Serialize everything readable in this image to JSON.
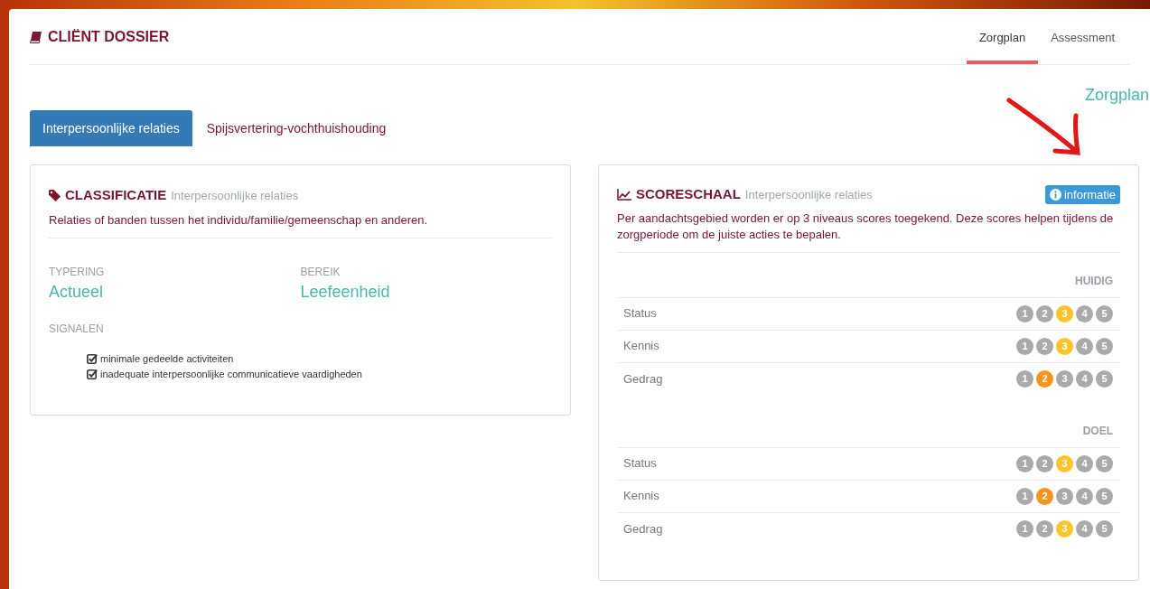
{
  "header": {
    "title": "CLIËNT DOSSIER",
    "tabs": [
      {
        "label": "Zorgplan",
        "selected": true
      },
      {
        "label": "Assessment",
        "selected": false
      }
    ]
  },
  "section_title": "Zorgplan",
  "pills": [
    {
      "label": "Interpersoonlijke relaties",
      "selected": true
    },
    {
      "label": "Spijsvertering-vochthuishouding",
      "selected": false
    }
  ],
  "classificatie": {
    "title": "CLASSIFICATIE",
    "subtitle": "Interpersoonlijke relaties",
    "description": "Relaties of banden tussen het individu/familie/gemeenschap en anderen.",
    "fields": [
      {
        "label": "TYPERING",
        "value": "Actueel"
      },
      {
        "label": "BEREIK",
        "value": "Leefeenheid"
      }
    ],
    "signals_label": "SIGNALEN",
    "signals": [
      {
        "text": "minimale gedeelde activiteiten",
        "checked": true
      },
      {
        "text": "inadequate interpersoonlijke communicatieve vaardigheden",
        "checked": true
      }
    ]
  },
  "scoreschaal": {
    "title": "SCORESCHAAL",
    "subtitle": "Interpersoonlijke relaties",
    "info_button": "informatie",
    "description": "Per aandachtsgebied worden er op 3 niveaus scores toegekend. Deze scores helpen tijdens de zorgperiode om de juiste acties te bepalen.",
    "groups": [
      {
        "heading": "HUIDIG",
        "rows": [
          {
            "label": "Status",
            "scores": [
              {
                "label": "1",
                "color": "#aaaaaa"
              },
              {
                "label": "2",
                "color": "#aaaaaa"
              },
              {
                "label": "3",
                "color": "#fdc52a"
              },
              {
                "label": "4",
                "color": "#aaaaaa"
              },
              {
                "label": "5",
                "color": "#aaaaaa"
              }
            ]
          },
          {
            "label": "Kennis",
            "scores": [
              {
                "label": "1",
                "color": "#aaaaaa"
              },
              {
                "label": "2",
                "color": "#aaaaaa"
              },
              {
                "label": "3",
                "color": "#fdc52a"
              },
              {
                "label": "4",
                "color": "#aaaaaa"
              },
              {
                "label": "5",
                "color": "#aaaaaa"
              }
            ]
          },
          {
            "label": "Gedrag",
            "scores": [
              {
                "label": "1",
                "color": "#aaaaaa"
              },
              {
                "label": "2",
                "color": "#f7941d"
              },
              {
                "label": "3",
                "color": "#aaaaaa"
              },
              {
                "label": "4",
                "color": "#aaaaaa"
              },
              {
                "label": "5",
                "color": "#aaaaaa"
              }
            ]
          }
        ]
      },
      {
        "heading": "DOEL",
        "rows": [
          {
            "label": "Status",
            "scores": [
              {
                "label": "1",
                "color": "#aaaaaa"
              },
              {
                "label": "2",
                "color": "#aaaaaa"
              },
              {
                "label": "3",
                "color": "#fdc52a"
              },
              {
                "label": "4",
                "color": "#aaaaaa"
              },
              {
                "label": "5",
                "color": "#aaaaaa"
              }
            ]
          },
          {
            "label": "Kennis",
            "scores": [
              {
                "label": "1",
                "color": "#aaaaaa"
              },
              {
                "label": "2",
                "color": "#f7941d"
              },
              {
                "label": "3",
                "color": "#aaaaaa"
              },
              {
                "label": "4",
                "color": "#aaaaaa"
              },
              {
                "label": "5",
                "color": "#aaaaaa"
              }
            ]
          },
          {
            "label": "Gedrag",
            "scores": [
              {
                "label": "1",
                "color": "#aaaaaa"
              },
              {
                "label": "2",
                "color": "#aaaaaa"
              },
              {
                "label": "3",
                "color": "#fdc52a"
              },
              {
                "label": "4",
                "color": "#aaaaaa"
              },
              {
                "label": "5",
                "color": "#aaaaaa"
              }
            ]
          }
        ]
      }
    ]
  }
}
